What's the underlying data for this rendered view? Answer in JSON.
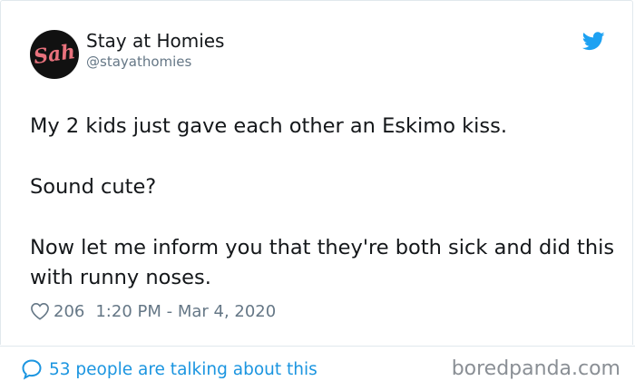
{
  "account": {
    "avatar_text": "Sah",
    "name": "Stay at Homies",
    "handle": "@stayathomies"
  },
  "tweet": {
    "paragraphs": [
      "My 2 kids just gave each other an Eskimo kiss.",
      "Sound cute?",
      "Now let me inform you that they're both sick and did this with runny noses."
    ],
    "likes": "206",
    "timestamp": "1:20 PM - Mar 4, 2020"
  },
  "footer": {
    "conversation": "53 people are talking about this"
  },
  "watermark": "boredpanda.com",
  "colors": {
    "twitter_blue": "#1da1f2",
    "link_blue": "#1b95e0",
    "text": "#14171a",
    "muted": "#657786",
    "avatar_accent": "#e9727d"
  },
  "icons": {
    "brand": "twitter-bird-icon",
    "like": "heart-icon",
    "reply": "speech-bubble-icon"
  }
}
